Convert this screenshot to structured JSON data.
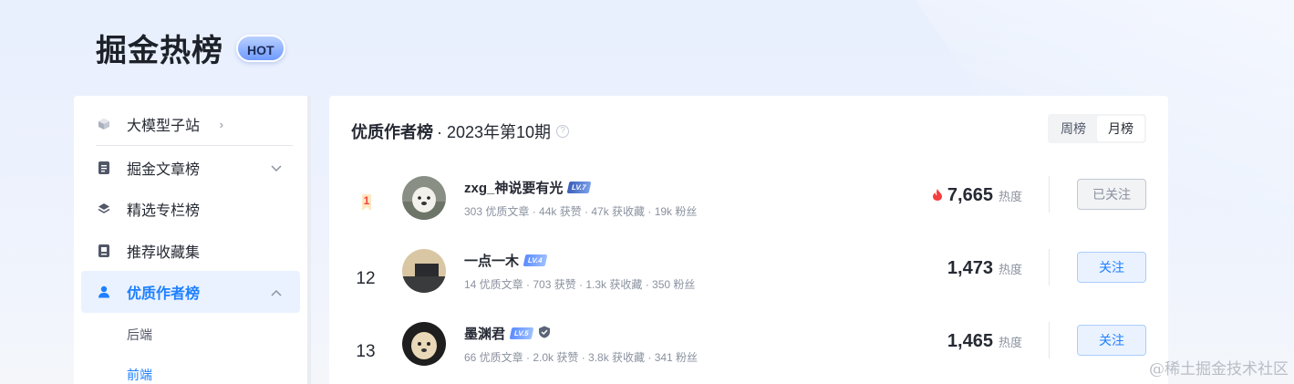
{
  "brand": {
    "title": "掘金热榜",
    "badge": "HOT"
  },
  "sidebar": {
    "items": [
      {
        "label": "大模型子站",
        "icon": "cube-icon",
        "chevron": "›"
      },
      {
        "label": "掘金文章榜",
        "icon": "document-icon",
        "chevron": "⌄"
      },
      {
        "label": "精选专栏榜",
        "icon": "layers-icon"
      },
      {
        "label": "推荐收藏集",
        "icon": "collection-icon"
      },
      {
        "label": "优质作者榜",
        "icon": "user-icon",
        "chevron": "⌃",
        "active": true
      }
    ],
    "subitems": [
      {
        "label": "后端"
      },
      {
        "label": "前端",
        "active": true
      }
    ]
  },
  "panel": {
    "title": "优质作者榜",
    "period": "· 2023年第10期",
    "help": "?",
    "tabs": [
      {
        "label": "周榜"
      },
      {
        "label": "月榜",
        "active": true
      }
    ]
  },
  "authors": [
    {
      "rank": "1",
      "name": "zxg_神说要有光",
      "level": "LV.7",
      "stats": "303 优质文章 ·  44k 获赞 ·  47k 获收藏 ·  19k 粉丝",
      "heat": "7,665",
      "heat_label": "热度",
      "follow": "已关注",
      "followed": true
    },
    {
      "rank": "12",
      "name": "一点一木",
      "level": "LV.4",
      "stats": "14 优质文章 ·  703 获赞 ·  1.3k 获收藏 ·  350 粉丝",
      "heat": "1,473",
      "heat_label": "热度",
      "follow": "关注",
      "followed": false
    },
    {
      "rank": "13",
      "name": "墨渊君",
      "level": "LV.5",
      "stats": "66 优质文章 ·  2.0k 获赞 ·  3.8k 获收藏 ·  341 粉丝",
      "heat": "1,465",
      "heat_label": "热度",
      "follow": "关注",
      "followed": false
    }
  ],
  "watermark": "@稀土掘金技术社区",
  "colors": {
    "accent": "#1e80ff",
    "fire": "#f53f3f",
    "text": "#252933",
    "muted": "#8a919f"
  }
}
